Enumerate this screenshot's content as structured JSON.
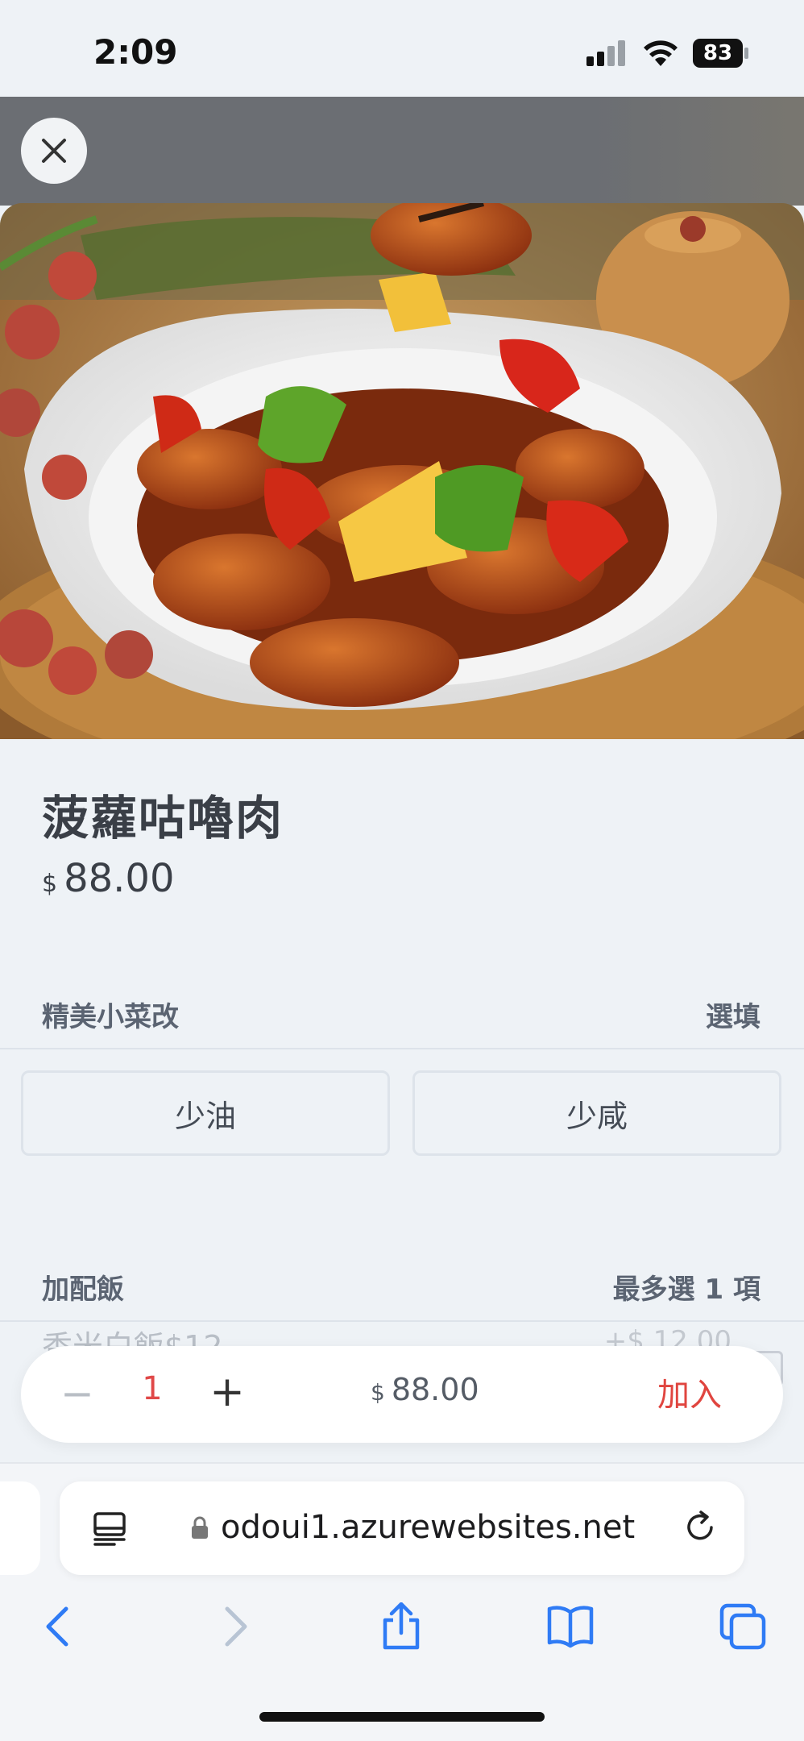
{
  "status_bar": {
    "time": "2:09",
    "battery": "83"
  },
  "product": {
    "name": "菠蘿咕嚕肉",
    "currency": "$",
    "price": "88.00"
  },
  "sections": [
    {
      "title": "精美小菜改",
      "hint": "選填",
      "options": [
        "少油",
        "少咸"
      ]
    },
    {
      "title": "加配飯",
      "hint": "最多選 1 項",
      "items": [
        {
          "label": "香米白飯$12",
          "price": "+$ 12.00"
        }
      ]
    }
  ],
  "cart": {
    "minus": "−",
    "quantity": "1",
    "plus": "+",
    "currency": "$",
    "total": "88.00",
    "add_label": "加入"
  },
  "browser": {
    "url": "odoui1.azurewebsites.net"
  },
  "icons": {
    "close": "close-icon",
    "reader": "reader-mode-icon",
    "lock": "lock-icon",
    "reload": "reload-icon",
    "back": "back-icon",
    "forward": "forward-icon",
    "share": "share-icon",
    "bookmarks": "bookmarks-icon",
    "tabs": "tabs-icon"
  },
  "colors": {
    "accent_red": "#e0453f",
    "safari_blue": "#2f7bf5",
    "background": "#eef2f6"
  }
}
